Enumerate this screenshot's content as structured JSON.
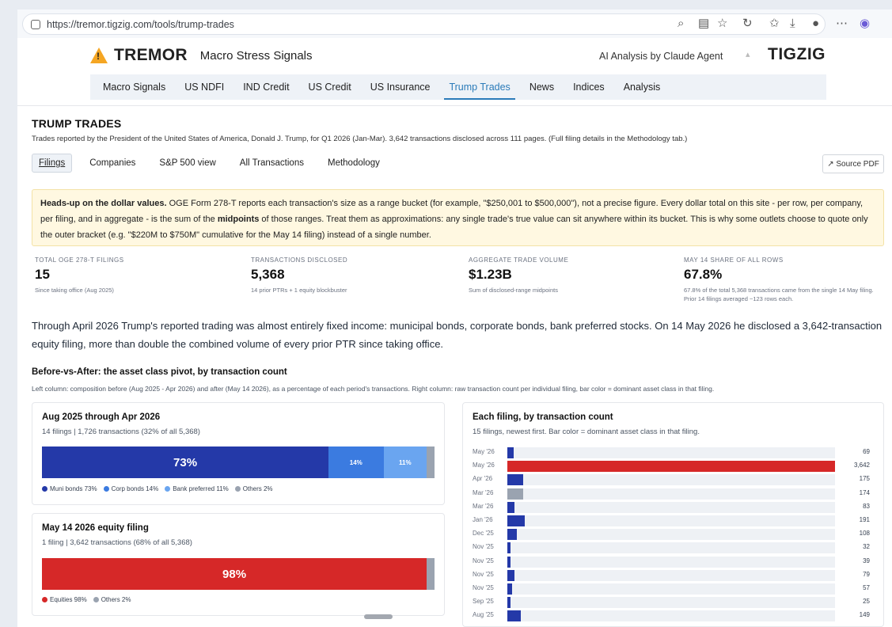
{
  "browser": {
    "url": "https://tremor.tigzig.com/tools/trump-trades"
  },
  "header": {
    "brand": "TREMOR",
    "subtitle": "Macro Stress Signals",
    "ai_label": "AI Analysis by Claude Agent",
    "partner": "TIGZIG"
  },
  "nav": {
    "items": [
      "Macro Signals",
      "US NDFI",
      "IND Credit",
      "US Credit",
      "US Insurance",
      "Trump Trades",
      "News",
      "Indices",
      "Analysis"
    ],
    "active": "Trump Trades"
  },
  "page": {
    "title": "TRUMP TRADES",
    "description": "Trades reported by the President of the United States of America, Donald J. Trump, for Q1 2026 (Jan-Mar). 3,642 transactions disclosed across 111 pages. (Full filing details in the Methodology tab.)"
  },
  "subtabs": {
    "items": [
      "Filings",
      "Companies",
      "S&P 500 view",
      "All Transactions",
      "Methodology"
    ],
    "active": "Filings",
    "source_button": "↗ Source PDF"
  },
  "alert": {
    "lead": "Heads-up on the dollar values.",
    "text1": " OGE Form 278-T reports each transaction's size as a range bucket (for example, \"$250,001 to $500,000\"), not a precise figure. Every dollar total on this site - per row, per company, per filing, and in aggregate - is the sum of the ",
    "bold": "midpoints",
    "text2": " of those ranges. Treat them as approximations: any single trade's true value can sit anywhere within its bucket. This is why some outlets choose to quote only the outer bracket (e.g. \"$220M to $750M\" cumulative for the May 14 filing) instead of a single number."
  },
  "stats": [
    {
      "label": "TOTAL OGE 278-T FILINGS",
      "value": "15",
      "note": "Since taking office (Aug 2025)"
    },
    {
      "label": "TRANSACTIONS DISCLOSED",
      "value": "5,368",
      "note": "14 prior PTRs + 1 equity blockbuster"
    },
    {
      "label": "AGGREGATE TRADE VOLUME",
      "value": "$1.23B",
      "note": "Sum of disclosed-range midpoints"
    },
    {
      "label": "MAY 14 SHARE OF ALL ROWS",
      "value": "67.8%",
      "note": "67.8% of the total 5,368 transactions came from the single 14 May filing. Prior 14 filings averaged ~123 rows each."
    }
  ],
  "intro": "Through April 2026 Trump's reported trading was almost entirely fixed income: municipal bonds, corporate bonds, bank preferred stocks. On 14 May 2026 he disclosed a 3,642-transaction equity filing, more than double the combined volume of every prior PTR since taking office.",
  "section": {
    "title": "Before-vs-After: the asset class pivot, by transaction count",
    "subtitle": "Left column: composition before (Aug 2025 - Apr 2026) and after (May 14 2026), as a percentage of each period's transactions. Right column: raw transaction count per individual filing, bar color = dominant asset class in that filing."
  },
  "before_card": {
    "title": "Aug 2025 through Apr 2026",
    "subtitle": "14 filings | 1,726 transactions (32% of all 5,368)",
    "segments": [
      {
        "label": "73%",
        "pct": 73,
        "color": "#2439a8"
      },
      {
        "label": "14%",
        "pct": 14,
        "color": "#3b7be0"
      },
      {
        "label": "11%",
        "pct": 11,
        "color": "#6aa5f0"
      },
      {
        "label": "",
        "pct": 2,
        "color": "#9aa3b0"
      }
    ],
    "legend": [
      {
        "text": "Muni bonds 73%",
        "color": "#2439a8"
      },
      {
        "text": "Corp bonds 14%",
        "color": "#3b7be0"
      },
      {
        "text": "Bank preferred 11%",
        "color": "#6aa5f0"
      },
      {
        "text": "Others 2%",
        "color": "#9aa3b0"
      }
    ]
  },
  "after_card": {
    "title": "May 14 2026 equity filing",
    "subtitle": "1 filing | 3,642 transactions (68% of all 5,368)",
    "segments": [
      {
        "label": "98%",
        "pct": 98,
        "color": "#d62828"
      },
      {
        "label": "",
        "pct": 2,
        "color": "#9aa3b0"
      }
    ],
    "legend": [
      {
        "text": "Equities 98%",
        "color": "#d62828"
      },
      {
        "text": "Others 2%",
        "color": "#9aa3b0"
      }
    ]
  },
  "chart_data": {
    "type": "bar",
    "orientation": "horizontal",
    "title": "Each filing, by transaction count",
    "subtitle": "15 filings, newest first. Bar color = dominant asset class in that filing.",
    "categories": [
      "May '26",
      "May '26",
      "Apr '26",
      "Mar '26",
      "Mar '26",
      "Jan '26",
      "Dec '25",
      "Nov '25",
      "Nov '25",
      "Nov '25",
      "Nov '25",
      "Sep '25",
      "Aug '25"
    ],
    "values": [
      69,
      3642,
      175,
      174,
      83,
      191,
      108,
      32,
      39,
      79,
      57,
      25,
      149
    ],
    "labels": [
      "69",
      "3,642",
      "175",
      "174",
      "83",
      "191",
      "108",
      "32",
      "39",
      "79",
      "57",
      "25",
      "149"
    ],
    "colors": [
      "#2439a8",
      "#d62828",
      "#2439a8",
      "#9aa3b0",
      "#2439a8",
      "#2439a8",
      "#2439a8",
      "#2439a8",
      "#2439a8",
      "#2439a8",
      "#2439a8",
      "#2439a8",
      "#2439a8"
    ],
    "xlim": [
      0,
      3642
    ]
  }
}
